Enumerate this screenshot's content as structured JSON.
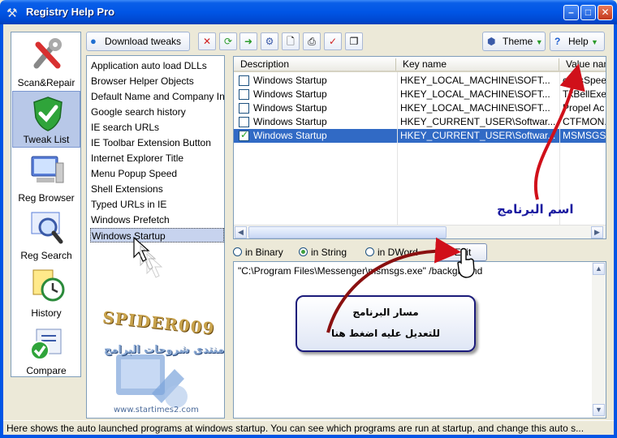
{
  "window": {
    "title": "Registry Help Pro"
  },
  "nav": [
    {
      "label": "Scan&Repair",
      "icon": "wrench-icon"
    },
    {
      "label": "Tweak List",
      "icon": "shield-check-icon",
      "active": true
    },
    {
      "label": "Reg Browser",
      "icon": "computer-icon"
    },
    {
      "label": "Reg Search",
      "icon": "magnifier-icon"
    },
    {
      "label": "History",
      "icon": "clock-icon"
    },
    {
      "label": "Compare",
      "icon": "check-circle-icon"
    }
  ],
  "toolbar": {
    "download": "Download tweaks",
    "theme": "Theme",
    "help": "Help"
  },
  "tweaks": [
    "Application auto load DLLs",
    "Browser Helper Objects",
    "Default Name and Company In",
    "Google search history",
    "IE search URLs",
    "IE Toolbar Extension Button",
    "Internet Explorer Title",
    "Menu Popup Speed",
    "Shell Extensions",
    "Typed URLs in IE",
    "Windows Prefetch",
    "Windows Startup"
  ],
  "grid": {
    "columns": [
      "Description",
      "Key name",
      "Value nam"
    ],
    "rows": [
      {
        "desc": "Windows Startup",
        "key": "HKEY_LOCAL_MACHINE\\SOFT...",
        "value": "cFosSpee",
        "checked": false
      },
      {
        "desc": "Windows Startup",
        "key": "HKEY_LOCAL_MACHINE\\SOFT...",
        "value": "TkBellExe",
        "checked": false
      },
      {
        "desc": "Windows Startup",
        "key": "HKEY_LOCAL_MACHINE\\SOFT...",
        "value": "Propel Ac",
        "checked": false
      },
      {
        "desc": "Windows Startup",
        "key": "HKEY_CURRENT_USER\\Softwar...",
        "value": "CTFMON.",
        "checked": false
      },
      {
        "desc": "Windows Startup",
        "key": "HKEY_CURRENT_USER\\Softwar...",
        "value": "MSMSGS",
        "checked": true,
        "selected": true
      }
    ]
  },
  "radios": {
    "binary": "in Binary",
    "string": "in String",
    "dword": "in DWord"
  },
  "edit_label": "Edit",
  "value_text": "\"C:\\Program Files\\Messenger\\msmsgs.exe\" /background",
  "status": "Here shows the auto launched programs at windows startup. You can see which programs are run at startup, and change this auto s...",
  "annotations": {
    "program_name": "اسم البرنامج",
    "callout_line1": "مسار البرنامج",
    "callout_line2": "للتعديل عليه اضغط هنا"
  },
  "logo": {
    "brand": "SPIDER009",
    "forum": "منتدى شروحات البرامج",
    "site": "www.startimes2.com"
  },
  "colors": {
    "titlebar": "#0055e5",
    "selection": "#316ac5",
    "arrow": "#d0101a"
  }
}
